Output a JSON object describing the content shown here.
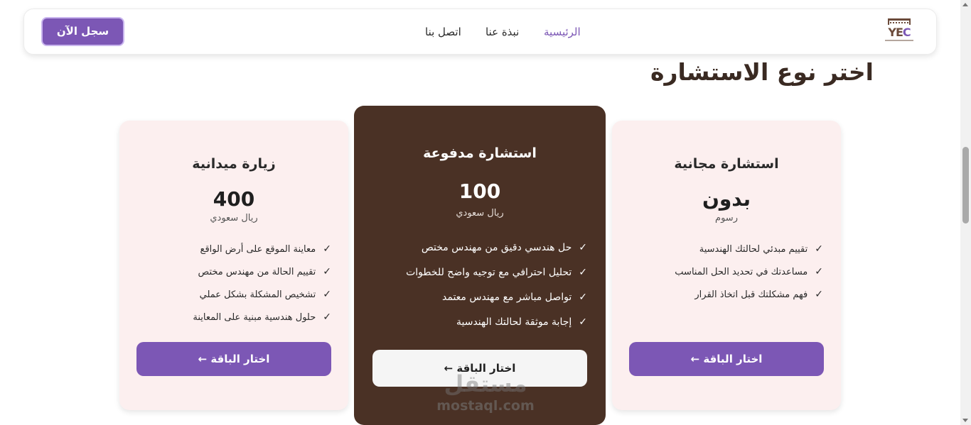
{
  "nav": {
    "logo_text": "YEC",
    "links": {
      "home": "الرئيسية",
      "about": "نبذة عنا",
      "contact": "اتصل بنا"
    },
    "cta": "سجل الآن"
  },
  "heading": "اختر نوع الاستشارة",
  "plans": {
    "free": {
      "title": "استشارة مجانية",
      "price": "بدون",
      "unit": "رسوم",
      "features": [
        "تقييم مبدئي لحالتك الهندسية",
        "مساعدتك في تحديد الحل المناسب",
        "فهم مشكلتك قبل اتخاذ القرار"
      ],
      "button": "اختار الباقة ←"
    },
    "paid": {
      "title": "استشارة مدفوعة",
      "price": "100",
      "unit": "ريال سعودي",
      "features": [
        "حل هندسي دقيق من مهندس مختص",
        "تحليل احترافي مع توجيه واضح للخطوات",
        "تواصل مباشر مع مهندس معتمد",
        "إجابة موثقة لحالتك الهندسية"
      ],
      "button": "اختار الباقة ←"
    },
    "visit": {
      "title": "زيارة ميدانية",
      "price": "400",
      "unit": "ريال سعودي",
      "features": [
        "معاينة الموقع على أرض الواقع",
        "تقييم الحالة من مهندس مختص",
        "تشخيص المشكلة بشكل عملي",
        "حلول هندسية مبنية على المعاينة"
      ],
      "button": "اختار الباقة ←"
    }
  },
  "check_icon": "✓",
  "watermark": {
    "arabic": "مستقل",
    "latin": "mostaql.com"
  },
  "colors": {
    "accent": "#7c57b5",
    "dark_card": "#4a3125",
    "light_card": "#fcefef",
    "heading": "#3a2a22"
  }
}
